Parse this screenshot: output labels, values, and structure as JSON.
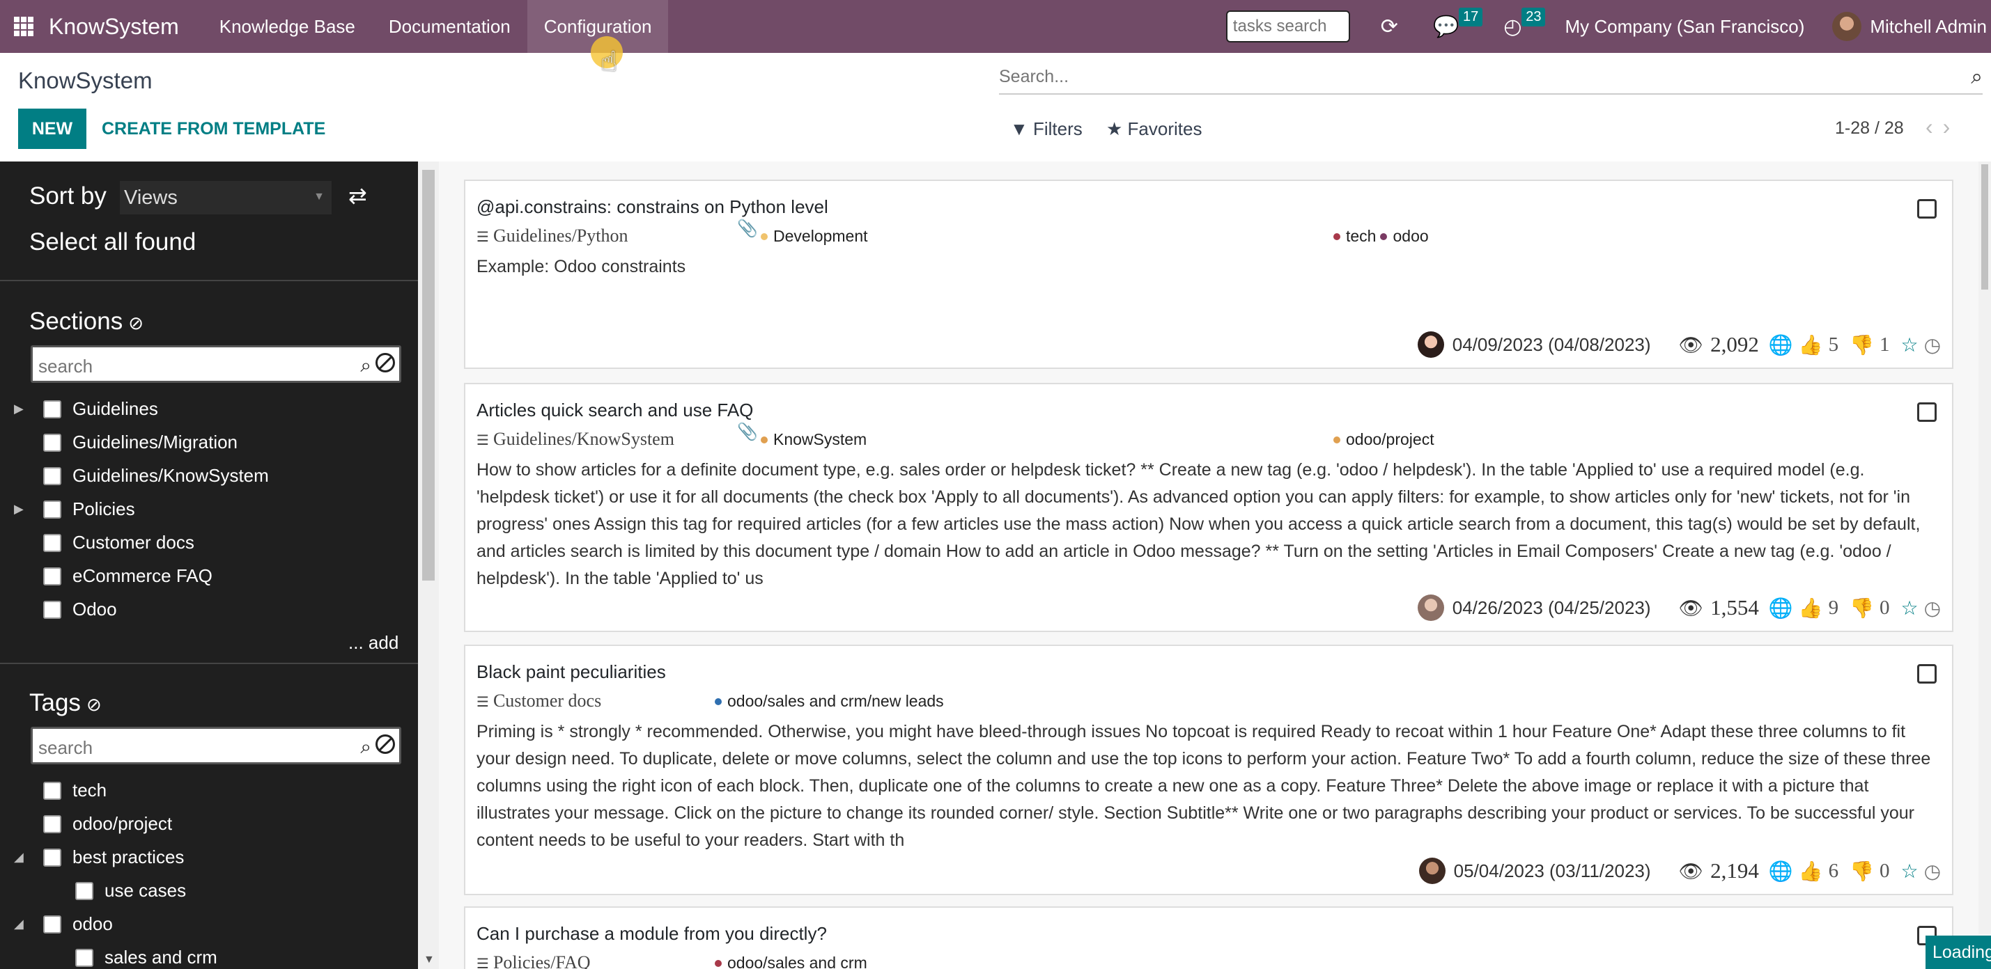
{
  "navbar": {
    "brand": "KnowSystem",
    "menu": [
      "Knowledge Base",
      "Documentation",
      "Configuration"
    ],
    "tasks_search_placeholder": "tasks search",
    "messages_count": "17",
    "activities_count": "23",
    "company": "My Company (San Francisco)",
    "user": "Mitchell Admin"
  },
  "control_panel": {
    "title": "KnowSystem",
    "new_label": "NEW",
    "template_label": "CREATE FROM TEMPLATE",
    "search_placeholder": "Search...",
    "filters_label": "Filters",
    "favorites_label": "Favorites",
    "pager": "1-28 / 28"
  },
  "sidebar": {
    "sort_label": "Sort by",
    "sort_value": "Views",
    "select_all": "Select all found",
    "sections_title": "Sections",
    "sections_search_placeholder": "search",
    "sections": [
      "Guidelines",
      "Guidelines/Migration",
      "Guidelines/KnowSystem",
      "Policies",
      "Customer docs",
      "eCommerce FAQ",
      "Odoo"
    ],
    "add_label": "... add",
    "tags_title": "Tags",
    "tags_search_placeholder": "search",
    "tags": [
      "tech",
      "odoo/project",
      "best practices",
      "use cases",
      "odoo",
      "sales and crm"
    ]
  },
  "articles": [
    {
      "title": "@api.constrains: constrains on Python level",
      "section": "Guidelines/Python",
      "kind": "Development",
      "tags": [
        "tech",
        "odoo"
      ],
      "text": "Example: Odoo constraints",
      "date": "04/09/2023 (04/08/2023)",
      "views": "2,092",
      "likes": "5",
      "dislikes": "1"
    },
    {
      "title": "Articles quick search and use FAQ",
      "section": "Guidelines/KnowSystem",
      "kind": "KnowSystem",
      "tags": [
        "odoo/project"
      ],
      "text": "How to show articles for a definite document type, e.g. sales order or helpdesk ticket? ** Create a new tag (e.g. 'odoo / helpdesk'). In the table 'Applied to' use a required model (e.g. 'helpdesk ticket') or use it for all documents (the check box 'Apply to all documents'). As advanced option you can apply filters: for example, to show articles only for 'new' tickets, not for 'in progress' ones Assign this tag for required articles (for a few articles use the mass action) Now when you access a quick article search from a document, this tag(s) would be set by default, and articles search is limited by this document type / domain How to add an article in Odoo message? ** Turn on the setting 'Articles in Email Composers' Create a new tag (e.g. 'odoo / helpdesk'). In the table 'Applied to' us",
      "date": "04/26/2023 (04/25/2023)",
      "views": "1,554",
      "likes": "9",
      "dislikes": "0"
    },
    {
      "title": "Black paint peculiarities",
      "section": "Customer docs",
      "tags": [
        "odoo/sales and crm/new leads"
      ],
      "text": "Priming is * strongly * recommended. Otherwise, you might have bleed-through issues No topcoat is required Ready to recoat within 1 hour Feature One* Adapt these three columns to fit your design need. To duplicate, delete or move columns, select the column and use the top icons to perform your action. Feature Two* To add a fourth column, reduce the size of these three columns using the right icon of each block. Then, duplicate one of the columns to create a new one as a copy. Feature Three* Delete the above image or replace it with a picture that illustrates your message. Click on the picture to change its rounded corner/ style. Section Subtitle** Write one or two paragraphs describing your product or services. To be successful your content needs to be useful to your readers. Start with th",
      "date": "05/04/2023 (03/11/2023)",
      "views": "2,194",
      "likes": "6",
      "dislikes": "0"
    },
    {
      "title": "Can I purchase a module from you directly?",
      "section": "Policies/FAQ",
      "tags": [
        "odoo/sales and crm"
      ]
    }
  ],
  "status": {
    "loading": "Loading"
  },
  "colors": {
    "navbar": "#714b67",
    "accent": "#017e84",
    "sidebar": "#1f1f1f"
  }
}
